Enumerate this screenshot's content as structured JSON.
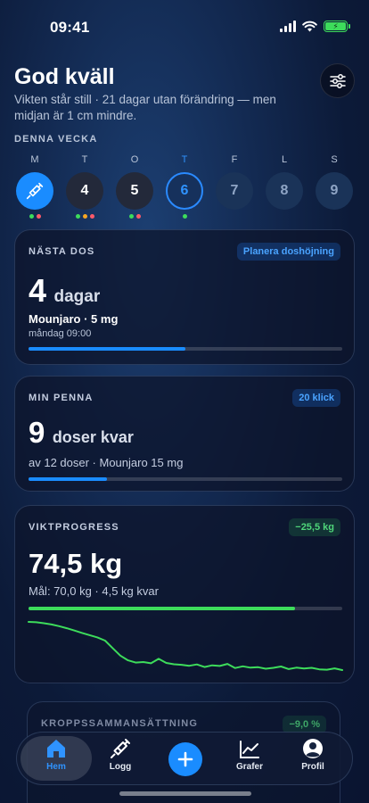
{
  "status_bar": {
    "time": "09:41"
  },
  "header": {
    "greeting": "God kväll",
    "subtitle": "Vikten står still · 21 dagar utan förändring — men midjan är 1 cm mindre."
  },
  "week": {
    "label": "DENNA VECKA",
    "days": [
      {
        "letter": "M",
        "number": "",
        "state": "dose",
        "dots": [
          "#3ddc5b",
          "#ff5a6a"
        ]
      },
      {
        "letter": "T",
        "number": "4",
        "state": "past",
        "dots": [
          "#3ddc5b",
          "#f5a623",
          "#ff5a6a"
        ]
      },
      {
        "letter": "O",
        "number": "5",
        "state": "past",
        "dots": [
          "#3ddc5b",
          "#ff5a6a"
        ]
      },
      {
        "letter": "T",
        "number": "6",
        "state": "today",
        "dots": [
          "#3ddc5b"
        ]
      },
      {
        "letter": "F",
        "number": "7",
        "state": "future",
        "dots": []
      },
      {
        "letter": "L",
        "number": "8",
        "state": "future",
        "dots": []
      },
      {
        "letter": "S",
        "number": "9",
        "state": "future",
        "dots": []
      }
    ]
  },
  "next_dose": {
    "title": "NÄSTA DOS",
    "badge": "Planera doshöjning",
    "value": "4",
    "unit": "dagar",
    "medication": "Mounjaro · 5 mg",
    "schedule": "måndag 09:00",
    "progress": 0.5,
    "color": "#1a8cff"
  },
  "pen": {
    "title": "MIN PENNA",
    "badge": "20 klick",
    "value": "9",
    "unit": "doser kvar",
    "detail": "av 12 doser · Mounjaro 15 mg",
    "progress": 0.25,
    "color": "#1a8cff"
  },
  "weight": {
    "title": "VIKTPROGRESS",
    "badge": "−25,5 kg",
    "value": "74,5 kg",
    "detail": "Mål: 70,0 kg · 4,5 kg kvar",
    "progress": 0.85,
    "color": "#3ddc5b",
    "trend": [
      100,
      99.8,
      99.3,
      98.6,
      97.7,
      96.6,
      95.4,
      94.1,
      92.9,
      91.7,
      90,
      86,
      82,
      79.5,
      78.3,
      78.6,
      77.9,
      80.3,
      78.1,
      77.4,
      77.1,
      76.6,
      77.3,
      75.9,
      76.8,
      76.5,
      77.6,
      75.4,
      76.3,
      75.6,
      75.8,
      75,
      75.5,
      76.2,
      74.8,
      75.6,
      75.1,
      75.5,
      74.7,
      74.5,
      75.2,
      74.3
    ]
  },
  "body_comp": {
    "title": "KROPPSSAMMANSÄTTNING",
    "badge": "−9,0 %"
  },
  "tabs": [
    {
      "label": "Hem",
      "icon": "house-icon",
      "active": true
    },
    {
      "label": "Logg",
      "icon": "syringe-icon",
      "active": false
    },
    {
      "label": "Lägg till",
      "icon": "plus-icon",
      "active": false
    },
    {
      "label": "Grafer",
      "icon": "chart-icon",
      "active": false
    },
    {
      "label": "Profil",
      "icon": "person-icon",
      "active": false
    }
  ]
}
